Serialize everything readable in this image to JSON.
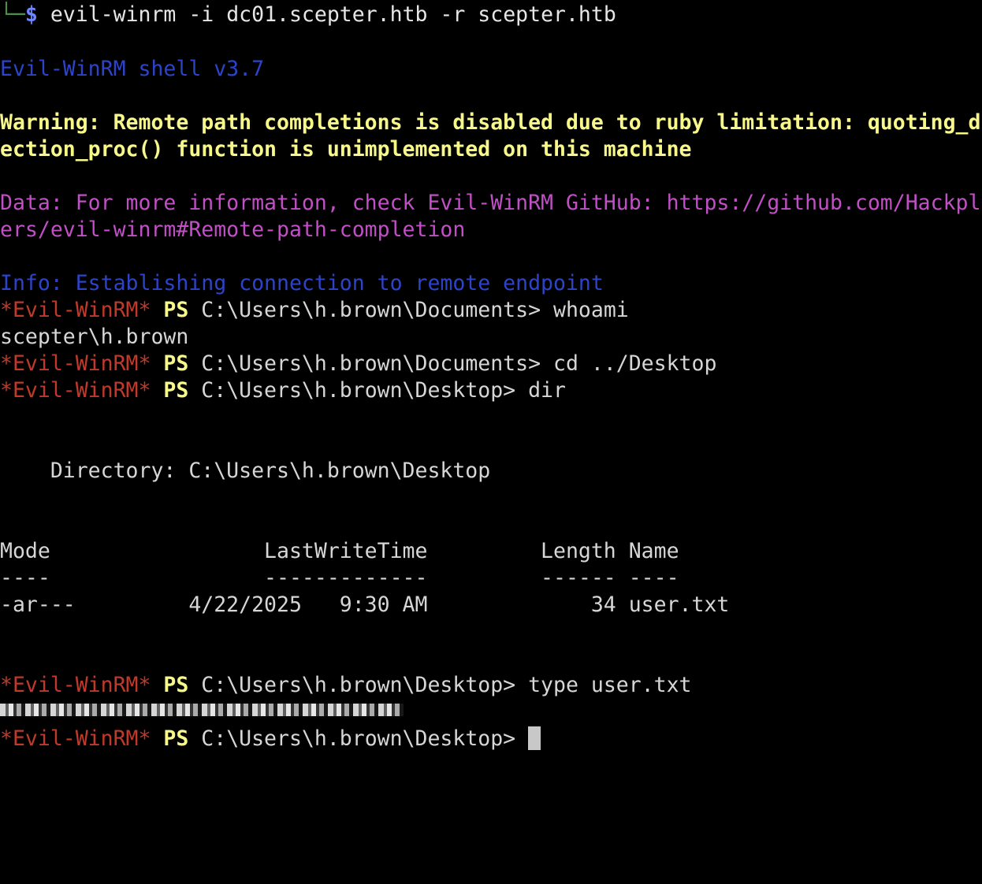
{
  "terminal": {
    "prompt_prefix": "└─",
    "prompt_dollar": "$",
    "command": " evil-winrm -i dc01.scepter.htb -r scepter.htb",
    "banner": "Evil-WinRM shell v3.7",
    "warning_line1": "Warning: Remote path completions is disabled due to ruby limitation: quoting_d",
    "warning_line2": "ection_proc() function is unimplemented on this machine",
    "data_line1": "Data: For more information, check Evil-WinRM GitHub: https://github.com/Hackpl",
    "data_line2": "ers/evil-winrm#Remote-path-completion",
    "info_line": "Info: Establishing connection to remote endpoint",
    "shell_name": "*Evil-WinRM*",
    "ps_label": " PS",
    "prompt_documents_whoami": " C:\\Users\\h.brown\\Documents> whoami",
    "whoami_output": "scepter\\h.brown",
    "prompt_documents_cd": " C:\\Users\\h.brown\\Documents> cd ../Desktop",
    "prompt_desktop_dir": " C:\\Users\\h.brown\\Desktop> dir",
    "directory_header": "    Directory: C:\\Users\\h.brown\\Desktop",
    "table_header": "Mode                 LastWriteTime         Length Name",
    "table_separator": "----                 -------------         ------ ----",
    "table_row": "-ar---         4/22/2025   9:30 AM             34 user.txt",
    "prompt_desktop_type": " C:\\Users\\h.brown\\Desktop> type user.txt",
    "prompt_desktop_final": " C:\\Users\\h.brown\\Desktop> "
  },
  "colors": {
    "background": "#000000",
    "banner_blue": "#2d44c8",
    "warning_yellow": "#f7f78a",
    "data_magenta": "#c14fc6",
    "shell_red": "#c0392b"
  }
}
